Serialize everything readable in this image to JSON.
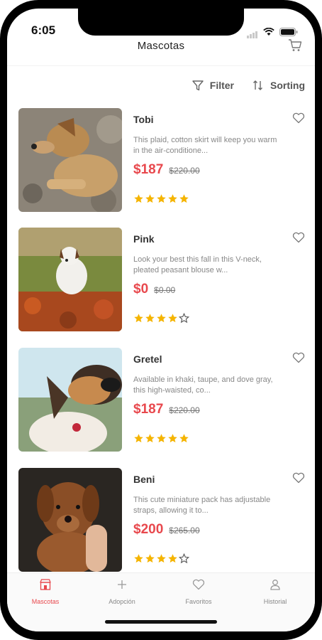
{
  "status": {
    "time": "6:05"
  },
  "header": {
    "title": "Mascotas"
  },
  "toolbar": {
    "filter_label": "Filter",
    "sorting_label": "Sorting"
  },
  "products": [
    {
      "name": "Tobi",
      "description": "This plaid, cotton skirt will keep you warm in the air-conditione...",
      "price": "$187",
      "old_price": "$220.00",
      "rating": 5,
      "image": "tan-puppy-lying"
    },
    {
      "name": "Pink",
      "description": "Look your best this fall in this V-neck, pleated peasant blouse w...",
      "price": "$0",
      "old_price": "$0.00",
      "rating": 4,
      "image": "white-terrier-in-flowers"
    },
    {
      "name": "Gretel",
      "description": "Available in khaki, taupe, and dove gray, this high-waisted, co...",
      "price": "$187",
      "old_price": "$220.00",
      "rating": 5,
      "image": "beagle-closeup"
    },
    {
      "name": "Beni",
      "description": "This cute miniature pack has adjustable straps, allowing it to...",
      "price": "$200",
      "old_price": "$265.00",
      "rating": 4,
      "image": "brown-puppy-held"
    }
  ],
  "tabs": [
    {
      "label": "Mascotas",
      "icon": "pet-store-icon",
      "active": true
    },
    {
      "label": "Adopción",
      "icon": "plus-icon",
      "active": false
    },
    {
      "label": "Favoritos",
      "icon": "heart-icon",
      "active": false
    },
    {
      "label": "Historial",
      "icon": "user-icon",
      "active": false
    }
  ],
  "colors": {
    "accent": "#e8484d",
    "star": "#f5b400",
    "text": "#333333",
    "muted": "#888888"
  }
}
